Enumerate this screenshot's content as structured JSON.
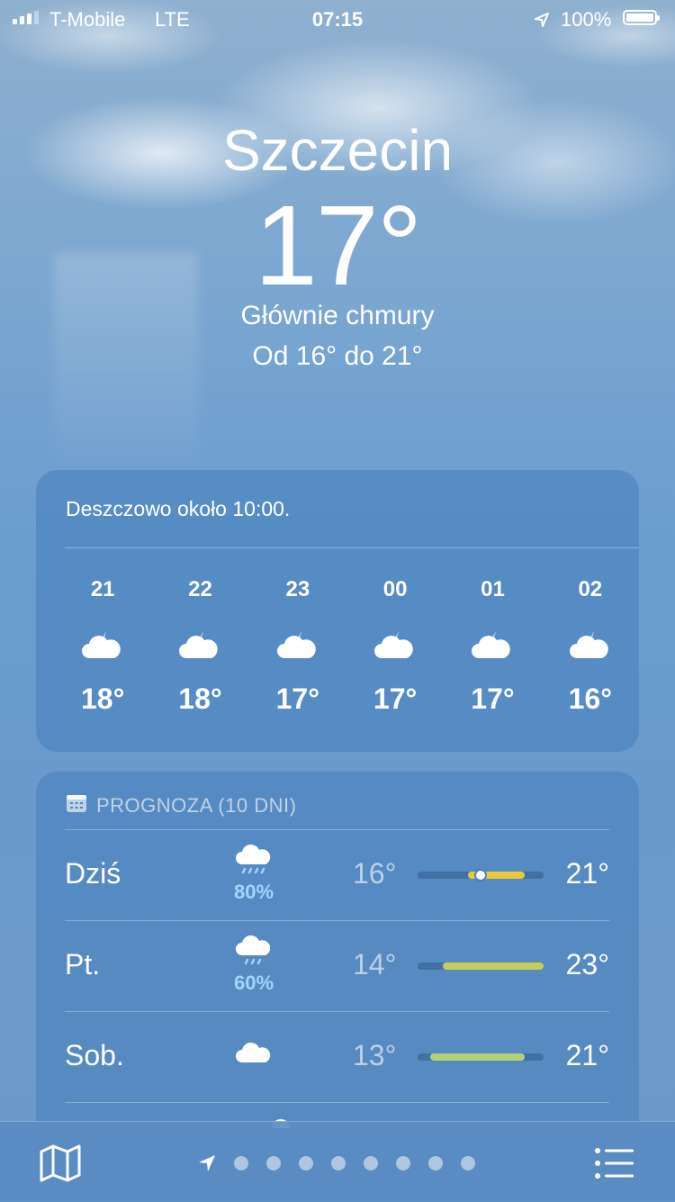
{
  "status_bar": {
    "carrier": "T-Mobile",
    "network": "LTE",
    "time": "07:15",
    "battery": "100%",
    "icons": [
      "signal-icon",
      "location-arrow-icon",
      "battery-icon"
    ]
  },
  "location": {
    "city": "Szczecin",
    "temperature": "17°",
    "condition": "Głównie chmury",
    "range": "Od 16°  do 21°"
  },
  "hourly": {
    "summary": "Deszczowo około 10:00.",
    "items": [
      {
        "hour": "21",
        "icon": "partly-cloudy-night-icon",
        "temp": "18°"
      },
      {
        "hour": "22",
        "icon": "partly-cloudy-night-icon",
        "temp": "18°"
      },
      {
        "hour": "23",
        "icon": "partly-cloudy-night-icon",
        "temp": "17°"
      },
      {
        "hour": "00",
        "icon": "partly-cloudy-night-icon",
        "temp": "17°"
      },
      {
        "hour": "01",
        "icon": "partly-cloudy-night-icon",
        "temp": "17°"
      },
      {
        "hour": "02",
        "icon": "partly-cloudy-night-icon",
        "temp": "16°"
      }
    ]
  },
  "daily": {
    "header": "PROGNOZA (10 DNI)",
    "header_icon": "calendar-icon",
    "days": [
      {
        "name": "Dziś",
        "icon": "rain-cloud-icon",
        "precip": "80%",
        "low": "16°",
        "high": "21°",
        "range_start": 0.4,
        "range_end": 0.85,
        "current_position": 0.5,
        "fill_color": "#e9c93a"
      },
      {
        "name": "Pt.",
        "icon": "rain-cloud-icon",
        "precip": "60%",
        "low": "14°",
        "high": "23°",
        "range_start": 0.2,
        "range_end": 1.0,
        "fill_color": "#c4cf5a"
      },
      {
        "name": "Sob.",
        "icon": "cloud-icon",
        "precip": "",
        "low": "13°",
        "high": "21°",
        "range_start": 0.1,
        "range_end": 0.85,
        "fill_color": "#b3d17a"
      }
    ]
  },
  "bottom_bar": {
    "icons": [
      "map-icon",
      "location-arrow-icon",
      "list-icon"
    ],
    "page_count": 8
  },
  "colors": {
    "accent_yellow": "#e9c93a",
    "precip_blue": "#a3d4ff"
  }
}
